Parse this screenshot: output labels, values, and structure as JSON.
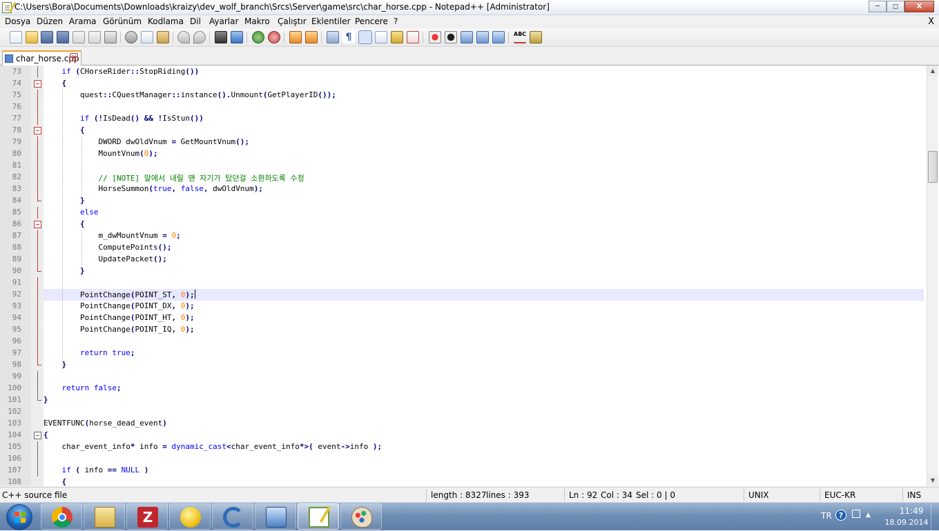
{
  "window": {
    "title": "C:\\Users\\Bora\\Documents\\Downloads\\kraizy\\dev_wolf_branch\\Srcs\\Server\\game\\src\\char_horse.cpp - Notepad++ [Administrator]",
    "minimize": "─",
    "maximize": "◻",
    "close": "X"
  },
  "menu": {
    "items": [
      "Dosya",
      "Düzen",
      "Arama",
      "Görünüm",
      "Kodlama",
      "Dil",
      "Ayarlar",
      "Makro",
      "Çalıştır",
      "Eklentiler",
      "Pencere",
      "?"
    ],
    "close_doc": "X"
  },
  "toolbar": {
    "icons": [
      "new-file-icon",
      "open-file-icon",
      "save-icon",
      "save-all-icon",
      "close-icon",
      "close-all-icon",
      "print-icon",
      "cut-icon",
      "copy-icon",
      "paste-icon",
      "undo-icon",
      "redo-icon",
      "find-icon",
      "replace-icon",
      "zoom-in-icon",
      "zoom-out-icon",
      "sync-vertical-icon",
      "sync-horizontal-icon",
      "word-wrap-icon",
      "show-all-chars-icon",
      "indent-guide-icon",
      "user-lang-icon",
      "doc-map-icon",
      "function-list-icon",
      "record-macro-icon",
      "stop-macro-icon",
      "play-macro-icon",
      "run-macro-multiple-icon",
      "save-macro-icon",
      "spell-check-icon",
      "plugin-icon"
    ]
  },
  "tab": {
    "label": "char_horse.cpp",
    "close": "✕"
  },
  "editor": {
    "current_line": 92,
    "lines": [
      {
        "n": "73",
        "html": "    <span class='kw'>if</span> <span class='op'>(</span>CHorseRider<span class='op'>::</span>StopRiding<span class='op'>())</span>"
      },
      {
        "n": "74",
        "html": "    <span class='op'>{</span>"
      },
      {
        "n": "75",
        "html": "        quest<span class='op'>::</span>CQuestManager<span class='op'>::</span>instance<span class='op'>().</span>Unmount<span class='op'>(</span>GetPlayerID<span class='op'>());</span>"
      },
      {
        "n": "76",
        "html": ""
      },
      {
        "n": "77",
        "html": "        <span class='kw'>if</span> <span class='op'>(!</span>IsDead<span class='op'>()</span> <span class='op'>&amp;&amp;</span> <span class='op'>!</span>IsStun<span class='op'>())</span>"
      },
      {
        "n": "78",
        "html": "        <span class='op'>{</span>"
      },
      {
        "n": "79",
        "html": "            DWORD dwOldVnum <span class='op'>=</span> GetMountVnum<span class='op'>();</span>"
      },
      {
        "n": "80",
        "html": "            MountVnum<span class='op'>(</span><span class='num'>0</span><span class='op'>);</span>"
      },
      {
        "n": "81",
        "html": ""
      },
      {
        "n": "82",
        "html": "            <span class='cmt'>// [NOTE] 말에서 내릴 땐 자기가 탔던걸 소환하도록 수정</span>"
      },
      {
        "n": "83",
        "html": "            HorseSummon<span class='op'>(</span><span class='kw'>true</span><span class='op'>,</span> <span class='kw'>false</span><span class='op'>,</span> dwOldVnum<span class='op'>);</span>"
      },
      {
        "n": "84",
        "html": "        <span class='op'>}</span>"
      },
      {
        "n": "85",
        "html": "        <span class='kw'>else</span>"
      },
      {
        "n": "86",
        "html": "        <span class='op'>{</span>"
      },
      {
        "n": "87",
        "html": "            m_dwMountVnum <span class='op'>=</span> <span class='num'>0</span><span class='op'>;</span>"
      },
      {
        "n": "88",
        "html": "            ComputePoints<span class='op'>();</span>"
      },
      {
        "n": "89",
        "html": "            UpdatePacket<span class='op'>();</span>"
      },
      {
        "n": "90",
        "html": "        <span class='op'>}</span>"
      },
      {
        "n": "91",
        "html": ""
      },
      {
        "n": "92",
        "html": "        PointChange<span class='op'>(</span>POINT_ST<span class='op'>,</span> <span class='num'>0</span><span class='op'>);</span><span class='caret'></span>"
      },
      {
        "n": "93",
        "html": "        PointChange<span class='op'>(</span>POINT_DX<span class='op'>,</span> <span class='num'>0</span><span class='op'>);</span>"
      },
      {
        "n": "94",
        "html": "        PointChange<span class='op'>(</span>POINT_HT<span class='op'>,</span> <span class='num'>0</span><span class='op'>);</span>"
      },
      {
        "n": "95",
        "html": "        PointChange<span class='op'>(</span>POINT_IQ<span class='op'>,</span> <span class='num'>0</span><span class='op'>);</span>"
      },
      {
        "n": "96",
        "html": ""
      },
      {
        "n": "97",
        "html": "        <span class='kw'>return</span> <span class='kw'>true</span><span class='op'>;</span>"
      },
      {
        "n": "98",
        "html": "    <span class='op'>}</span>"
      },
      {
        "n": "99",
        "html": ""
      },
      {
        "n": "100",
        "html": "    <span class='kw'>return</span> <span class='kw'>false</span><span class='op'>;</span>"
      },
      {
        "n": "101",
        "html": "<span class='op'>}</span>"
      },
      {
        "n": "102",
        "html": ""
      },
      {
        "n": "103",
        "html": "EVENTFUNC<span class='op'>(</span>horse_dead_event<span class='op'>)</span>"
      },
      {
        "n": "104",
        "html": "<span class='op'>{</span>"
      },
      {
        "n": "105",
        "html": "    char_event_info<span class='op'>*</span> info <span class='op'>=</span> <span class='kw'>dynamic_cast</span><span class='op'>&lt;</span>char_event_info<span class='op'>*&gt;(</span> event<span class='op'>-&gt;</span>info <span class='op'>);</span>"
      },
      {
        "n": "106",
        "html": ""
      },
      {
        "n": "107",
        "html": "    <span class='kw'>if</span> <span class='op'>(</span> info <span class='op'>==</span> <span class='kw'>NULL</span> <span class='op'>)</span>"
      },
      {
        "n": "108",
        "html": "    <span class='op'>{</span>"
      }
    ]
  },
  "status": {
    "filetype": "C++ source file",
    "length": "length : 8327",
    "lines": "lines : 393",
    "ln": "Ln : 92",
    "col": "Col : 34",
    "sel": "Sel : 0 | 0",
    "eol": "UNIX",
    "encoding": "EUC-KR",
    "mode": "INS"
  },
  "taskbar": {
    "apps": [
      "chrome-icon",
      "explorer-icon",
      "filezilla-icon",
      "yellow-app-icon",
      "ccleaner-icon",
      "vpn-icon",
      "notepadpp-icon",
      "paint-icon"
    ],
    "active_app": "notepadpp-icon",
    "lang": "TR",
    "help": "?",
    "time": "11:49",
    "date": "18.09.2014"
  },
  "colors": {
    "keyword": "#0000ff",
    "number": "#ff8000",
    "comment": "#008000",
    "operator": "#000080",
    "current_line_bg": "#e8e8ff"
  }
}
